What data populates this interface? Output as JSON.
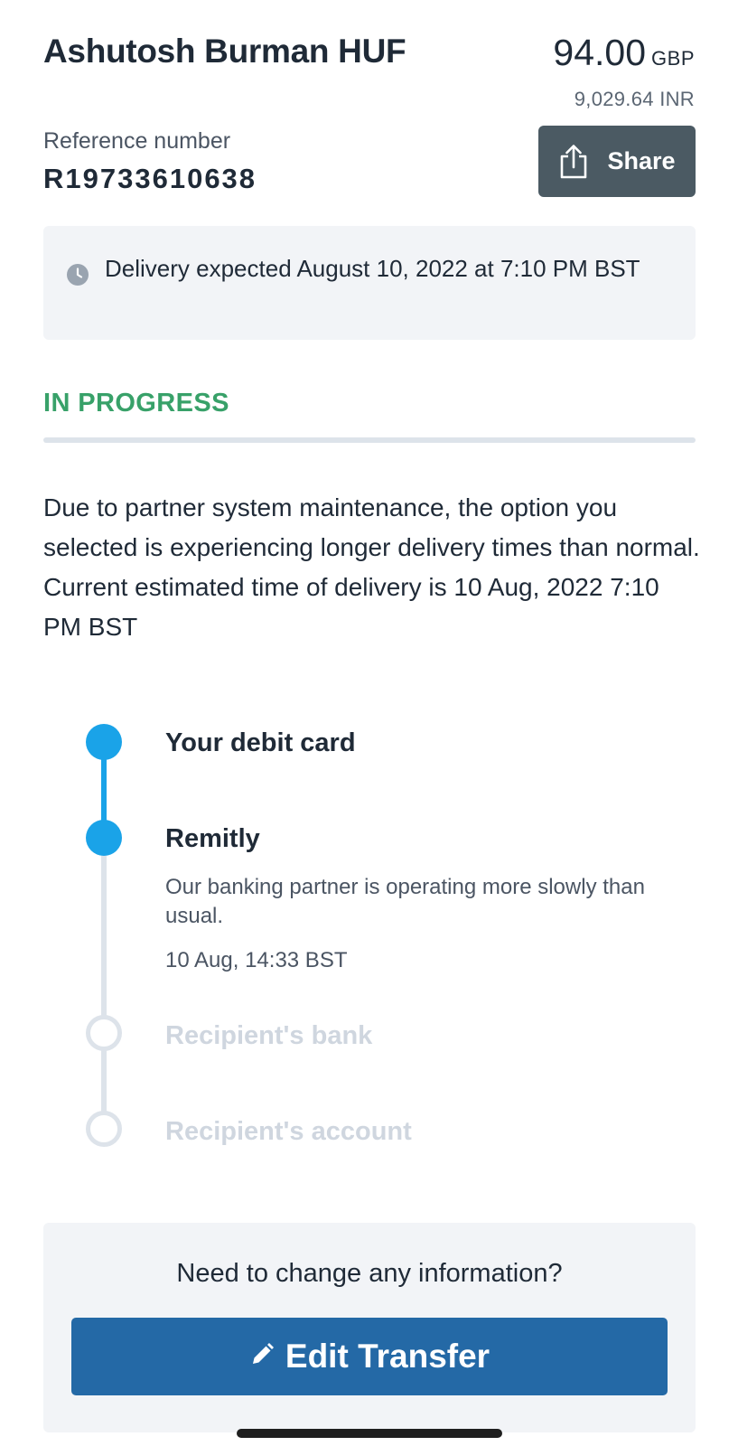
{
  "transfer": {
    "recipient_name": "Ashutosh Burman HUF",
    "amount": "94.00",
    "amount_currency": "GBP",
    "amount_converted": "9,029.64 INR",
    "reference_label": "Reference number",
    "reference_number": "R19733610638",
    "share_label": "Share",
    "share_icon": "share-icon"
  },
  "delivery": {
    "icon": "clock-icon",
    "text": "Delivery expected August 10, 2022 at 7:10 PM BST"
  },
  "status": {
    "label": "IN PROGRESS",
    "color": "#38a169",
    "notice": "Due to partner system maintenance, the option you selected is experiencing longer delivery times than normal. Current estimated time of delivery is 10 Aug, 2022 7:10 PM BST"
  },
  "timeline": {
    "accent_color": "#1aa3e8",
    "steps": [
      {
        "title": "Your debit card",
        "state": "completed"
      },
      {
        "title": "Remitly",
        "state": "current",
        "description": "Our banking partner is operating more slowly than usual.",
        "time": "10 Aug, 14:33 BST"
      },
      {
        "title": "Recipient's bank",
        "state": "pending"
      },
      {
        "title": "Recipient's account",
        "state": "pending"
      }
    ]
  },
  "change": {
    "question": "Need to change any information?",
    "edit_label": "Edit Transfer",
    "edit_icon": "pencil-icon",
    "button_color": "#2469a6"
  }
}
